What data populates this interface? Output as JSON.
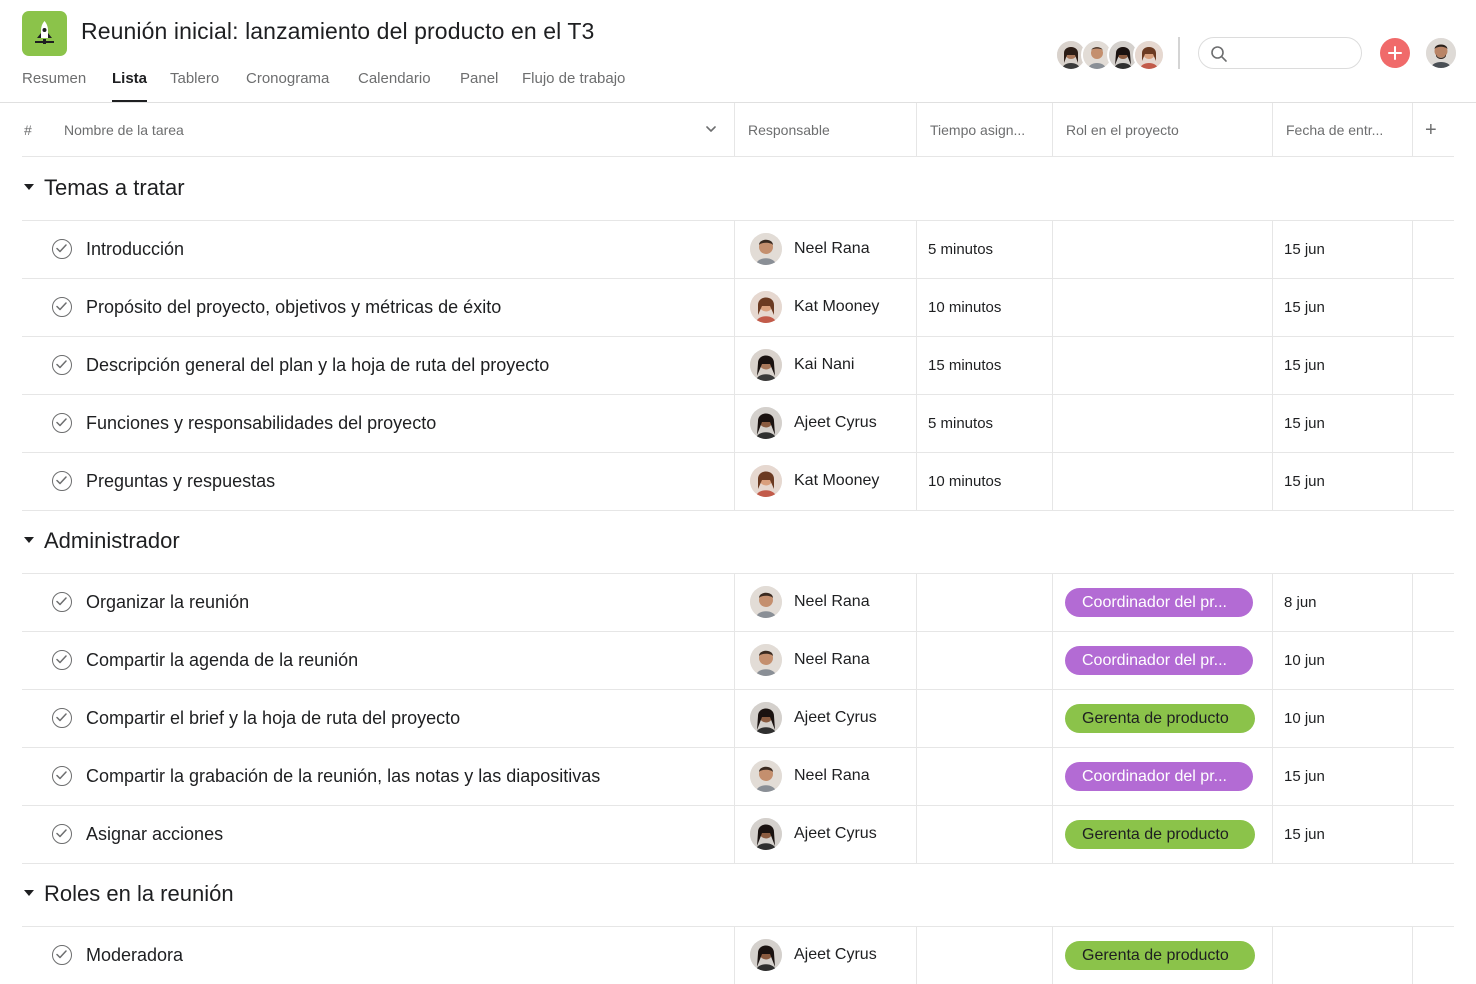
{
  "project": {
    "title": "Reunión inicial: lanzamiento del producto en el T3",
    "icon": "rocket-icon",
    "accent": "#8bc34a"
  },
  "tabs": [
    "Resumen",
    "Lista",
    "Tablero",
    "Cronograma",
    "Calendario",
    "Panel",
    "Flujo de trabajo"
  ],
  "active_tab": "Lista",
  "search": {
    "placeholder": "",
    "value": ""
  },
  "columns": {
    "number": "#",
    "task_name": "Nombre de la tarea",
    "assignee": "Responsable",
    "time": "Tiempo asign...",
    "role": "Rol en el proyecto",
    "due": "Fecha de entr...",
    "add": "+"
  },
  "colors": {
    "purple_tag": "#b36bd4",
    "green_tag": "#8bc34a",
    "add_button": "#f06a6a"
  },
  "sections": [
    {
      "title": "Temas a tratar",
      "tasks": [
        {
          "name": "Introducción",
          "assignee": "Neel Rana",
          "time": "5 minutos",
          "role": "",
          "role_color": "",
          "due": "15 jun"
        },
        {
          "name": "Propósito del proyecto, objetivos y métricas de éxito",
          "assignee": "Kat Mooney",
          "time": "10 minutos",
          "role": "",
          "role_color": "",
          "due": "15 jun"
        },
        {
          "name": "Descripción general del plan y la hoja de ruta del proyecto",
          "assignee": "Kai Nani",
          "time": "15 minutos",
          "role": "",
          "role_color": "",
          "due": "15 jun"
        },
        {
          "name": "Funciones y responsabilidades del proyecto",
          "assignee": "Ajeet Cyrus",
          "time": "5 minutos",
          "role": "",
          "role_color": "",
          "due": "15 jun"
        },
        {
          "name": "Preguntas y respuestas",
          "assignee": "Kat Mooney",
          "time": "10 minutos",
          "role": "",
          "role_color": "",
          "due": "15 jun"
        }
      ]
    },
    {
      "title": "Administrador",
      "tasks": [
        {
          "name": "Organizar la reunión",
          "assignee": "Neel Rana",
          "time": "",
          "role": "Coordinador del pr...",
          "role_color": "purple",
          "due": "8 jun"
        },
        {
          "name": "Compartir la agenda de la reunión",
          "assignee": "Neel Rana",
          "time": "",
          "role": "Coordinador del pr...",
          "role_color": "purple",
          "due": "10 jun"
        },
        {
          "name": "Compartir el brief y la hoja de ruta del proyecto",
          "assignee": "Ajeet Cyrus",
          "time": "",
          "role": "Gerenta de producto",
          "role_color": "green",
          "due": "10 jun"
        },
        {
          "name": "Compartir la grabación de la reunión, las notas y las diapositivas",
          "assignee": "Neel Rana",
          "time": "",
          "role": "Coordinador del pr...",
          "role_color": "purple",
          "due": "15 jun"
        },
        {
          "name": "Asignar acciones",
          "assignee": "Ajeet Cyrus",
          "time": "",
          "role": "Gerenta de producto",
          "role_color": "green",
          "due": "15 jun"
        }
      ]
    },
    {
      "title": "Roles en la reunión",
      "tasks": [
        {
          "name": "Moderadora",
          "assignee": "Ajeet Cyrus",
          "time": "",
          "role": "Gerenta de producto",
          "role_color": "green",
          "due": ""
        }
      ]
    }
  ]
}
